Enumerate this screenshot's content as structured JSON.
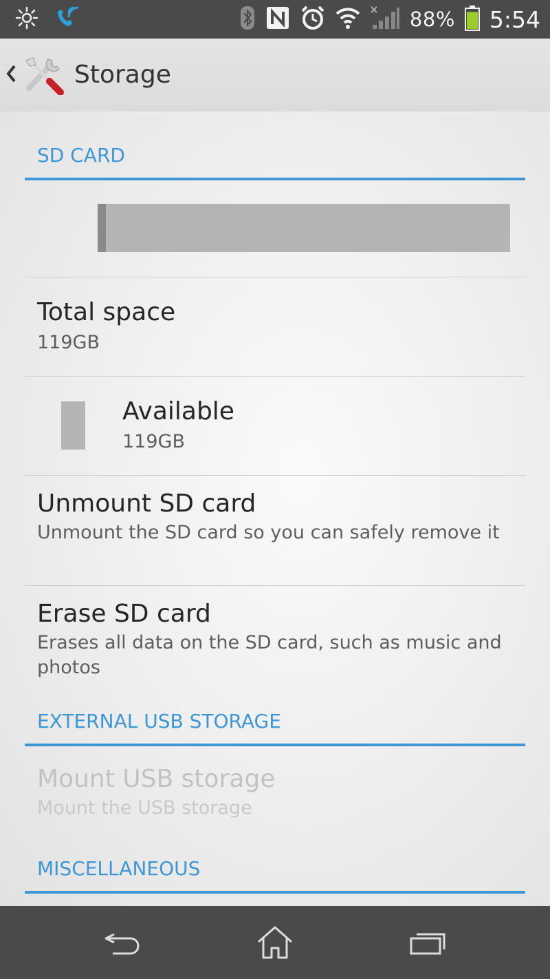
{
  "status_bar": {
    "battery_percent": "88%",
    "time": "5:54",
    "icons": [
      "brightness-icon",
      "wifi-calling-icon",
      "bluetooth-icon",
      "nfc-icon",
      "alarm-icon",
      "wifi-icon",
      "signal-icon",
      "battery-icon"
    ],
    "battery_level": 0.88
  },
  "action_bar": {
    "title": "Storage",
    "icon": "settings-tools-icon",
    "back_icon": "back-caret-icon"
  },
  "sections": {
    "sd_card": "SD CARD",
    "external_usb": "EXTERNAL USB STORAGE",
    "misc": "MISCELLANEOUS"
  },
  "usage_bar": {
    "used_fraction": 0.02
  },
  "items": {
    "total_space": {
      "title": "Total space",
      "summary": "119GB"
    },
    "available": {
      "title": "Available",
      "summary": "119GB"
    },
    "unmount": {
      "title": "Unmount SD card",
      "summary": "Unmount the SD card so you can safely remove it"
    },
    "erase": {
      "title": "Erase SD card",
      "summary": "Erases all data on the SD card, such as music and photos"
    },
    "mount_usb": {
      "title": "Mount USB storage",
      "summary": "Mount the USB storage",
      "enabled": false
    }
  },
  "nav_bar": {
    "icons": [
      "back-icon",
      "home-icon",
      "recent-apps-icon"
    ]
  },
  "colors": {
    "accent": "#3d97d6",
    "status_bar": "#4a4a4a",
    "battery_fill": "#9ccc2a"
  }
}
